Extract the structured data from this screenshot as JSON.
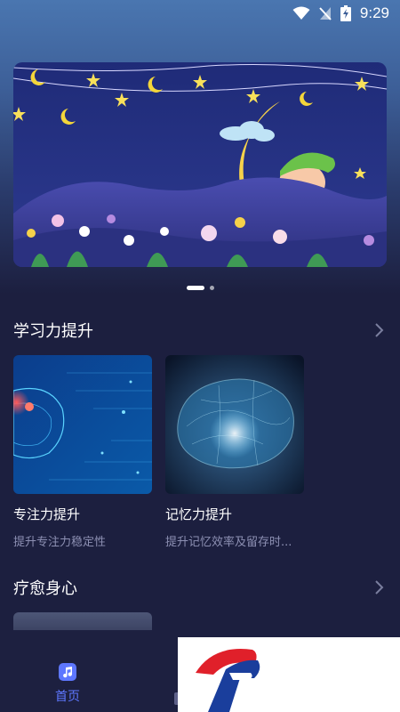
{
  "status_bar": {
    "time": "9:29",
    "icons": [
      "wifi-icon",
      "signal-off-icon",
      "battery-charging-icon"
    ]
  },
  "banner": {
    "image_name": "sleeping-child-on-moon-illustration",
    "page_count": 2,
    "active_page": 1
  },
  "sections": [
    {
      "title": "学习力提升",
      "cards": [
        {
          "title": "专注力提升",
          "subtitle": "提升专注力稳定性",
          "image_name": "brain-digital-illustration"
        },
        {
          "title": "记忆力提升",
          "subtitle": "提升记忆效率及留存时...",
          "image_name": "brain-network-illustration"
        }
      ]
    },
    {
      "title": "疗愈身心",
      "cards": []
    }
  ],
  "bottom_nav": {
    "items": [
      {
        "label": "首页",
        "icon": "music-note-icon",
        "active": true
      }
    ]
  },
  "colors": {
    "background": "#1c1f3f",
    "accent": "#5e77ff",
    "subtitle": "#8d90b3",
    "watermark_red": "#e0202a",
    "watermark_blue": "#1a3e9c"
  }
}
